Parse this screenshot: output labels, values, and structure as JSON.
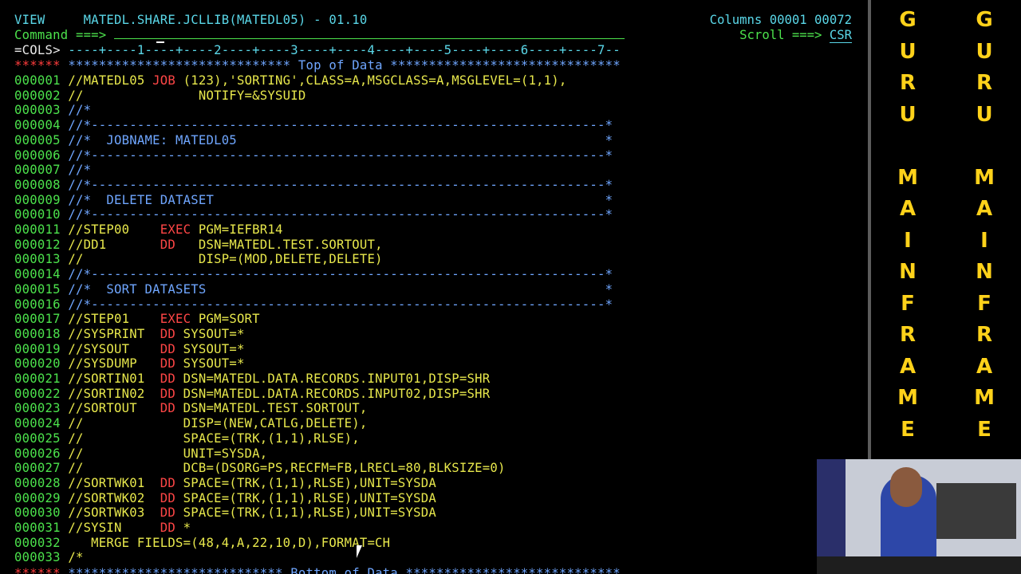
{
  "header": {
    "mode": "VIEW",
    "dataset": "MATEDL.SHARE.JCLLIB(MATEDL05) - 01.10",
    "columns_label": "Columns",
    "columns_from": "00001",
    "columns_to": "00072",
    "command_label": "Command ===>",
    "command_value": "",
    "scroll_label": "Scroll ===>",
    "scroll_value": "CSR"
  },
  "ruler": {
    "prefix": "=COLS>",
    "scale": " ----+----1----+----2----+----3----+----4----+----5----+----6----+----7--"
  },
  "top_line": {
    "seq": "******",
    "text": " ***************************** Top of Data ******************************"
  },
  "bottom_line": {
    "seq": "******",
    "text": " **************************** Bottom of Data ****************************"
  },
  "lines": [
    {
      "seq": "000001",
      "segs": [
        {
          "t": "//MATEDL05 ",
          "c": "tx"
        },
        {
          "t": "JOB",
          "c": "kw"
        },
        {
          "t": " (123),'SORTING',CLASS=A,MSGCLASS=A,MSGLEVEL=(1,1),",
          "c": "tx"
        }
      ]
    },
    {
      "seq": "000002",
      "segs": [
        {
          "t": "//               NOTIFY=&SYSUID",
          "c": "tx"
        }
      ]
    },
    {
      "seq": "000003",
      "segs": [
        {
          "t": "//*",
          "c": "cmt"
        }
      ]
    },
    {
      "seq": "000004",
      "segs": [
        {
          "t": "//*-------------------------------------------------------------------*",
          "c": "cmt"
        }
      ]
    },
    {
      "seq": "000005",
      "segs": [
        {
          "t": "//*  JOBNAME: MATEDL05                                                *",
          "c": "cmt"
        }
      ]
    },
    {
      "seq": "000006",
      "segs": [
        {
          "t": "//*-------------------------------------------------------------------*",
          "c": "cmt"
        }
      ]
    },
    {
      "seq": "000007",
      "segs": [
        {
          "t": "//*",
          "c": "cmt"
        }
      ]
    },
    {
      "seq": "000008",
      "segs": [
        {
          "t": "//*-------------------------------------------------------------------*",
          "c": "cmt"
        }
      ]
    },
    {
      "seq": "000009",
      "segs": [
        {
          "t": "//*  DELETE DATASET                                                   *",
          "c": "cmt"
        }
      ]
    },
    {
      "seq": "000010",
      "segs": [
        {
          "t": "//*-------------------------------------------------------------------*",
          "c": "cmt"
        }
      ]
    },
    {
      "seq": "000011",
      "segs": [
        {
          "t": "//STEP00    ",
          "c": "tx"
        },
        {
          "t": "EXEC",
          "c": "kw"
        },
        {
          "t": " PGM=IEFBR14",
          "c": "tx"
        }
      ]
    },
    {
      "seq": "000012",
      "segs": [
        {
          "t": "//DD1       ",
          "c": "tx"
        },
        {
          "t": "DD",
          "c": "kw"
        },
        {
          "t": "   DSN=MATEDL.TEST.SORTOUT,",
          "c": "tx"
        }
      ]
    },
    {
      "seq": "000013",
      "segs": [
        {
          "t": "//               DISP=(MOD,DELETE,DELETE)",
          "c": "tx"
        }
      ]
    },
    {
      "seq": "000014",
      "segs": [
        {
          "t": "//*-------------------------------------------------------------------*",
          "c": "cmt"
        }
      ]
    },
    {
      "seq": "000015",
      "segs": [
        {
          "t": "//*  SORT DATASETS                                                    *",
          "c": "cmt"
        }
      ]
    },
    {
      "seq": "000016",
      "segs": [
        {
          "t": "//*-------------------------------------------------------------------*",
          "c": "cmt"
        }
      ]
    },
    {
      "seq": "000017",
      "segs": [
        {
          "t": "//STEP01    ",
          "c": "tx"
        },
        {
          "t": "EXEC",
          "c": "kw"
        },
        {
          "t": " PGM=SORT",
          "c": "tx"
        }
      ]
    },
    {
      "seq": "000018",
      "segs": [
        {
          "t": "//SYSPRINT  ",
          "c": "tx"
        },
        {
          "t": "DD",
          "c": "kw"
        },
        {
          "t": " SYSOUT=*",
          "c": "tx"
        }
      ]
    },
    {
      "seq": "000019",
      "segs": [
        {
          "t": "//SYSOUT    ",
          "c": "tx"
        },
        {
          "t": "DD",
          "c": "kw"
        },
        {
          "t": " SYSOUT=*",
          "c": "tx"
        }
      ]
    },
    {
      "seq": "000020",
      "segs": [
        {
          "t": "//SYSDUMP   ",
          "c": "tx"
        },
        {
          "t": "DD",
          "c": "kw"
        },
        {
          "t": " SYSOUT=*",
          "c": "tx"
        }
      ]
    },
    {
      "seq": "000021",
      "segs": [
        {
          "t": "//SORTIN01  ",
          "c": "tx"
        },
        {
          "t": "DD",
          "c": "kw"
        },
        {
          "t": " DSN=MATEDL.DATA.RECORDS.INPUT01,DISP=SHR",
          "c": "tx"
        }
      ]
    },
    {
      "seq": "000022",
      "segs": [
        {
          "t": "//SORTIN02  ",
          "c": "tx"
        },
        {
          "t": "DD",
          "c": "kw"
        },
        {
          "t": " DSN=MATEDL.DATA.RECORDS.INPUT02,DISP=SHR",
          "c": "tx"
        }
      ]
    },
    {
      "seq": "000023",
      "segs": [
        {
          "t": "//SORTOUT   ",
          "c": "tx"
        },
        {
          "t": "DD",
          "c": "kw"
        },
        {
          "t": " DSN=MATEDL.TEST.SORTOUT,",
          "c": "tx"
        }
      ]
    },
    {
      "seq": "000024",
      "segs": [
        {
          "t": "//             DISP=(NEW,CATLG,DELETE),",
          "c": "tx"
        }
      ]
    },
    {
      "seq": "000025",
      "segs": [
        {
          "t": "//             SPACE=(TRK,(1,1),RLSE),",
          "c": "tx"
        }
      ]
    },
    {
      "seq": "000026",
      "segs": [
        {
          "t": "//             UNIT=SYSDA,",
          "c": "tx"
        }
      ]
    },
    {
      "seq": "000027",
      "segs": [
        {
          "t": "//             DCB=(DSORG=PS,RECFM=FB,LRECL=80,BLKSIZE=0)",
          "c": "tx"
        }
      ]
    },
    {
      "seq": "000028",
      "segs": [
        {
          "t": "//SORTWK01  ",
          "c": "tx"
        },
        {
          "t": "DD",
          "c": "kw"
        },
        {
          "t": " SPACE=(TRK,(1,1),RLSE),UNIT=SYSDA",
          "c": "tx"
        }
      ]
    },
    {
      "seq": "000029",
      "segs": [
        {
          "t": "//SORTWK02  ",
          "c": "tx"
        },
        {
          "t": "DD",
          "c": "kw"
        },
        {
          "t": " SPACE=(TRK,(1,1),RLSE),UNIT=SYSDA",
          "c": "tx"
        }
      ]
    },
    {
      "seq": "000030",
      "segs": [
        {
          "t": "//SORTWK03  ",
          "c": "tx"
        },
        {
          "t": "DD",
          "c": "kw"
        },
        {
          "t": " SPACE=(TRK,(1,1),RLSE),UNIT=SYSDA",
          "c": "tx"
        }
      ]
    },
    {
      "seq": "000031",
      "segs": [
        {
          "t": "//SYSIN     ",
          "c": "tx"
        },
        {
          "t": "DD",
          "c": "kw"
        },
        {
          "t": " *",
          "c": "tx"
        }
      ]
    },
    {
      "seq": "000032",
      "segs": [
        {
          "t": "   MERGE FIELDS=(48,4,A,22,10,D),FORMAT=CH",
          "c": "tx"
        }
      ]
    },
    {
      "seq": "000033",
      "segs": [
        {
          "t": "/*",
          "c": "tx"
        }
      ]
    }
  ],
  "banner": {
    "left_column": [
      "G",
      "U",
      "R",
      "U",
      "",
      "M",
      "A",
      "I",
      "N",
      "F",
      "R",
      "A",
      "M",
      "E"
    ],
    "right_column": [
      "G",
      "U",
      "R",
      "U",
      "",
      "M",
      "A",
      "I",
      "N",
      "F",
      "R",
      "A",
      "M",
      "E"
    ]
  },
  "colors": {
    "background": "#000000",
    "sequence": "#4ce24c",
    "jcl_text": "#e8e84c",
    "keyword": "#ff4646",
    "comment": "#6fa6ff",
    "header": "#5ad7e8",
    "banner": "#ffd21a"
  }
}
